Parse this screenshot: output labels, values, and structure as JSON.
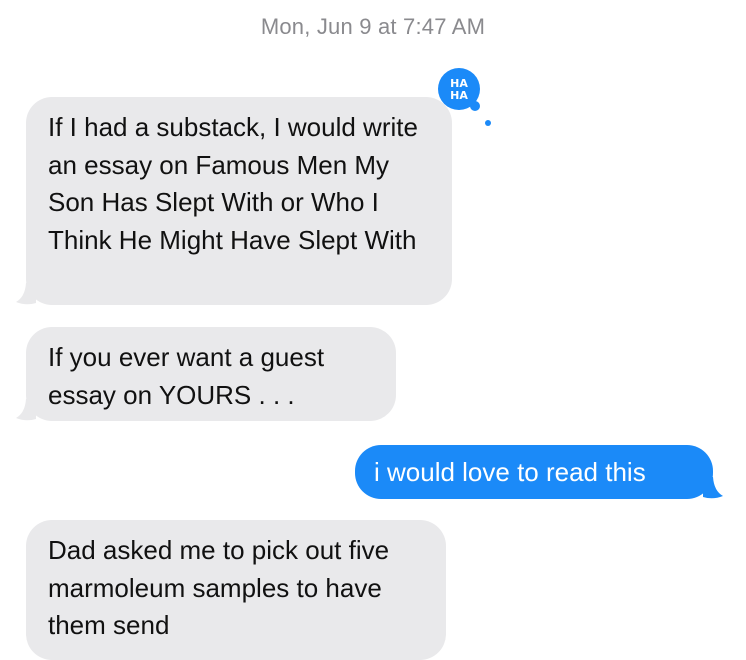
{
  "conversation": {
    "timestamp": "Mon, Jun 9 at 7:47 AM"
  },
  "messages": [
    {
      "direction": "incoming",
      "text": "If I had a substack, I would write an essay on Famous Men My Son Has Slept With or Who I Think He Might Have Slept With",
      "tapback": "HA HA"
    },
    {
      "direction": "incoming",
      "text": "If you ever want a guest essay on YOURS . . ."
    },
    {
      "direction": "outgoing",
      "text": "i would love to read this"
    },
    {
      "direction": "incoming",
      "text": "Dad asked me to pick out five marmoleum samples to have them send"
    }
  ],
  "colors": {
    "incoming_bubble": "#e9e9eb",
    "outgoing_bubble": "#1b8af8",
    "timestamp_text": "#8a8a8e"
  },
  "icons": {
    "tapback": "haha-tapback-icon"
  }
}
